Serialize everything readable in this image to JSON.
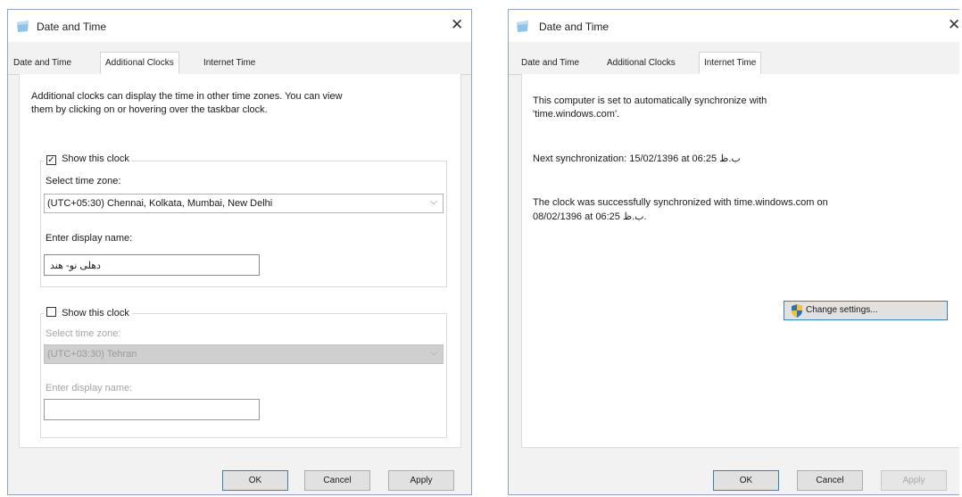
{
  "left_dialog": {
    "title": "Date and Time",
    "close_glyph": "✕",
    "tabs": [
      "Date and Time",
      "Additional Clocks",
      "Internet Time"
    ],
    "active_tab": "Additional Clocks",
    "description_line1": "Additional clocks can display the time in other time zones. You can view",
    "description_line2": "them by clicking on or hovering over the taskbar clock.",
    "clock1": {
      "show_label": "Show this clock",
      "checked": true,
      "check_glyph": "✓",
      "timezone_label": "Select time zone:",
      "timezone_value": "(UTC+05:30) Chennai, Kolkata, Mumbai, New Delhi",
      "display_name_label": "Enter display name:",
      "display_name_value": "دهلی نو- هند"
    },
    "clock2": {
      "show_label": "Show this clock",
      "checked": false,
      "timezone_label": "Select time zone:",
      "timezone_value": "(UTC+03:30) Tehran",
      "display_name_label": "Enter display name:",
      "display_name_value": ""
    },
    "buttons": {
      "ok": "OK",
      "cancel": "Cancel",
      "apply": "Apply"
    },
    "dropdown_arrow": "⌵"
  },
  "right_dialog": {
    "title": "Date and Time",
    "close_glyph": "✕",
    "tabs": [
      "Date and Time",
      "Additional Clocks",
      "Internet Time"
    ],
    "active_tab": "Internet Time",
    "sync_line1": "This computer is set to automatically synchronize with",
    "sync_line2": "'time.windows.com'.",
    "next_sync": "Next synchronization: 15/02/1396 at 06:25 ب.ظ",
    "success_line1": "The clock was successfully synchronized with time.windows.com on",
    "success_line2": "08/02/1396 at 06:25 ب.ظ.",
    "change_settings_label": "Change settings...",
    "buttons": {
      "ok": "OK",
      "cancel": "Cancel",
      "apply": "Apply"
    }
  },
  "colors": {
    "title_icon": "#8fc3e8",
    "focus_border": "#3c7fb1",
    "shield_blue": "#2f6fb6",
    "shield_yellow": "#f2c230"
  }
}
